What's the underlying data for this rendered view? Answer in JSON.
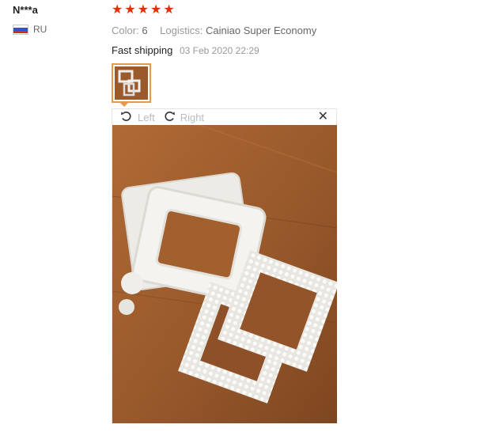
{
  "buyer": {
    "name": "N***a",
    "country_code": "RU"
  },
  "review": {
    "rating": 5,
    "stars": [
      "★",
      "★",
      "★",
      "★",
      "★"
    ],
    "color_label": "Color:",
    "color_value": "6",
    "logistics_label": "Logistics:",
    "logistics_value": "Cainiao Super Economy",
    "feedback_text": "Fast shipping",
    "date": "03 Feb 2020 22:29"
  },
  "viewer": {
    "rotate_left_label": "Left",
    "rotate_right_label": "Right",
    "rotate_left_icon": "rotate-left-icon",
    "rotate_right_icon": "rotate-right-icon",
    "close_icon": "close-icon"
  },
  "colors": {
    "star": "#e62e04",
    "thumb_border": "#e39a4a",
    "wood": "#9a5a2c"
  }
}
